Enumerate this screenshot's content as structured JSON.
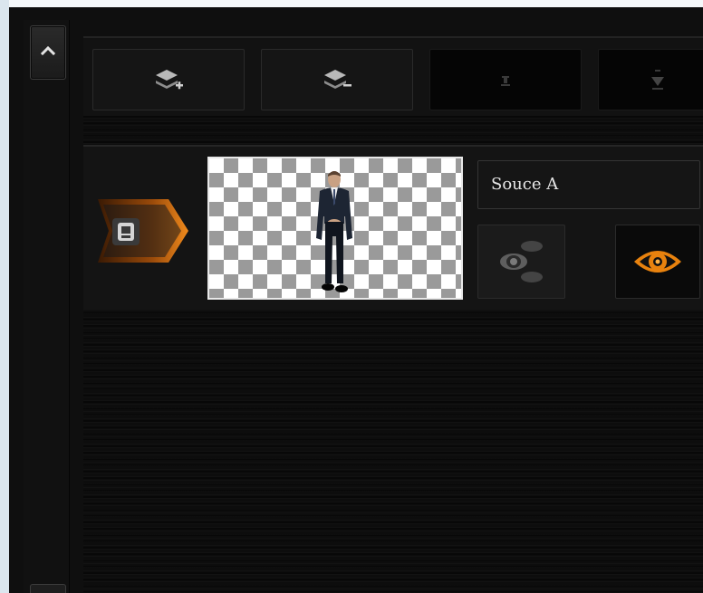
{
  "toolbar": {
    "buttons": [
      {
        "icon": "layer-add-icon",
        "enabled": true
      },
      {
        "icon": "layer-remove-icon",
        "enabled": true
      },
      {
        "icon": "move-down-icon",
        "enabled": false
      },
      {
        "icon": "move-bottom-icon",
        "enabled": false
      }
    ]
  },
  "source_row": {
    "badge_icon": "live-input-icon",
    "name": "Souce A",
    "thumbnail_icon": "presenter-thumbnail",
    "visibility_off_icon": "hidden-eye-icon",
    "visibility_on_icon": "visible-eye-icon"
  },
  "colors": {
    "accent": "#e8820e",
    "panel": "#141414",
    "background": "#0d0d0d"
  }
}
